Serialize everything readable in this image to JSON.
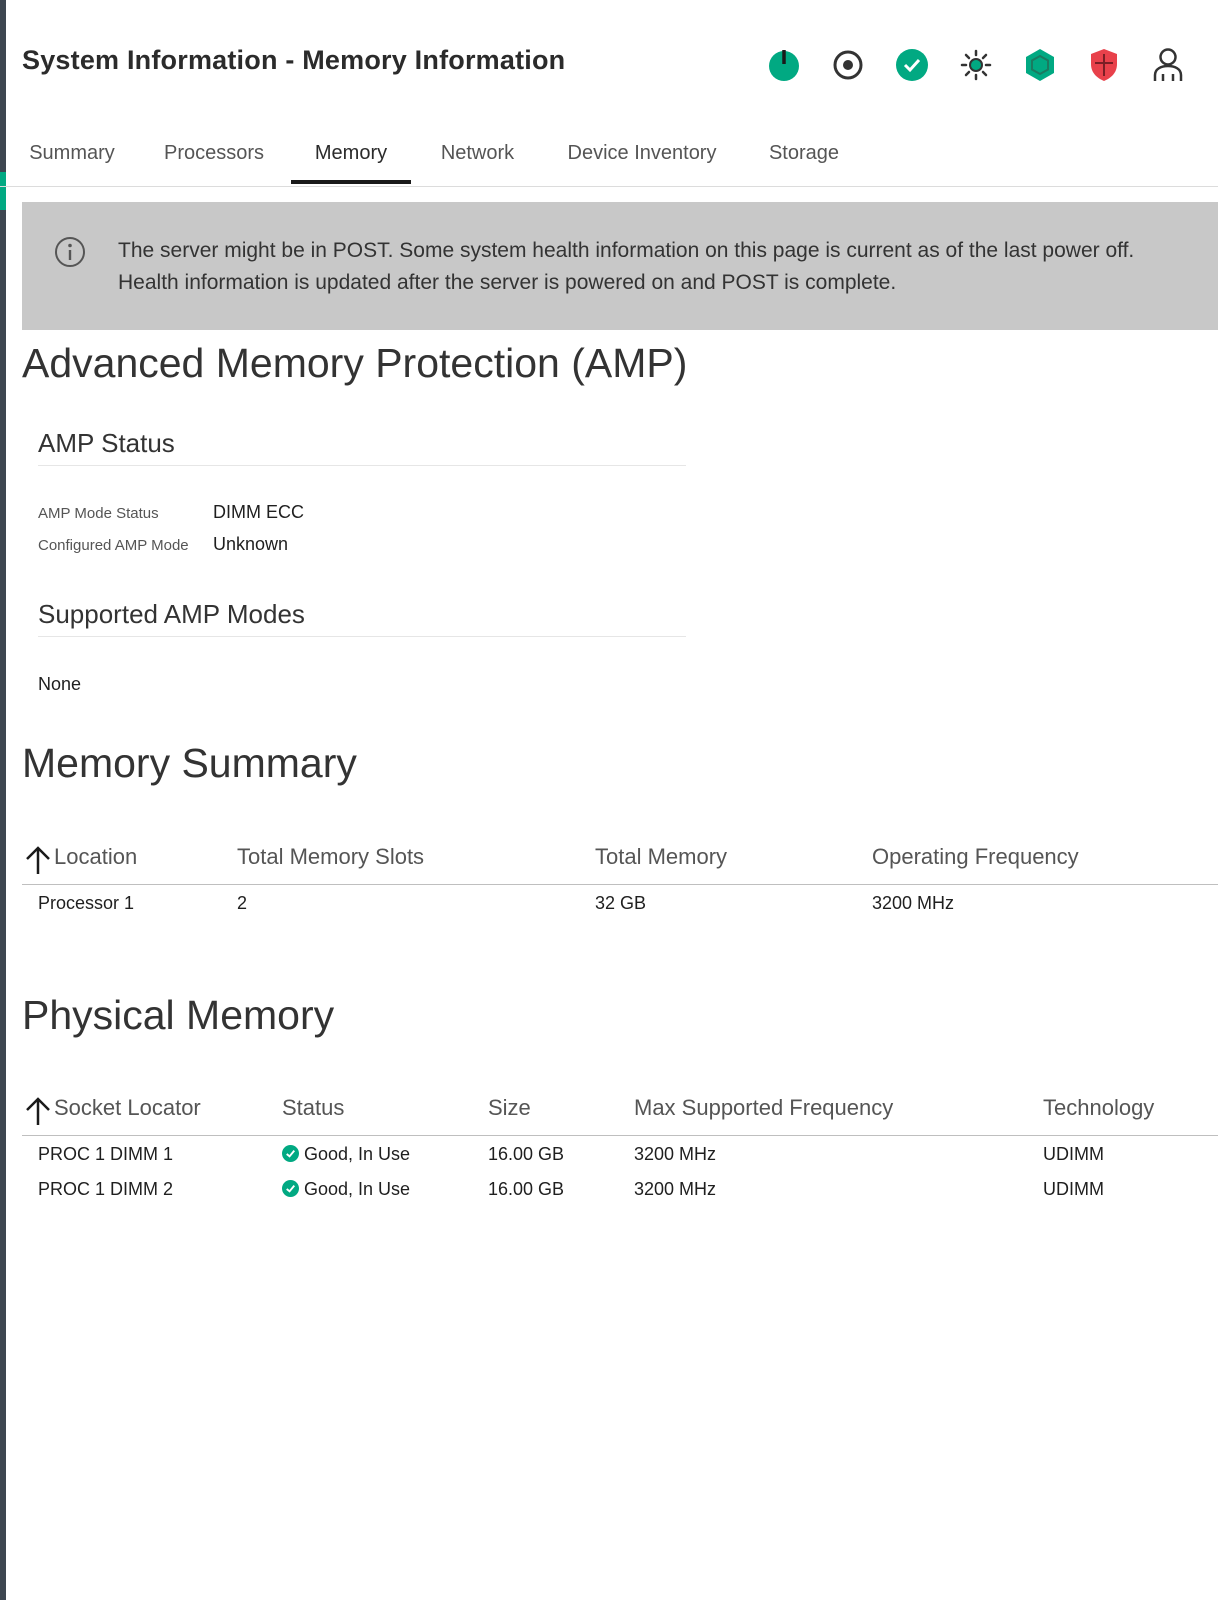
{
  "header": {
    "title": "System Information - Memory Information",
    "icons": [
      "power-icon",
      "uid-indicator-icon",
      "health-ok-icon",
      "ambient-light-icon",
      "security-hexagon-icon",
      "security-shield-icon",
      "user-icon"
    ]
  },
  "tabs": [
    {
      "label": "Summary"
    },
    {
      "label": "Processors"
    },
    {
      "label": "Memory"
    },
    {
      "label": "Network"
    },
    {
      "label": "Device Inventory"
    },
    {
      "label": "Storage"
    }
  ],
  "active_tab": "Memory",
  "banner": {
    "icon": "info-icon",
    "line1": "The server might be in POST. Some system health information on this page is current as of the last power off.",
    "line2": "Health information is updated after the server is powered on and POST is complete."
  },
  "amp": {
    "title": "Advanced Memory Protection (AMP)",
    "status_title": "AMP Status",
    "mode_status_label": "AMP Mode Status",
    "mode_status_value": "DIMM ECC",
    "configured_label": "Configured AMP Mode",
    "configured_value": "Unknown",
    "supported_title": "Supported AMP Modes",
    "supported_value": "None"
  },
  "memory_summary": {
    "title": "Memory Summary",
    "columns": [
      "Location",
      "Total Memory Slots",
      "Total Memory",
      "Operating Frequency"
    ],
    "rows": [
      [
        "Processor 1",
        "2",
        "32 GB",
        "3200 MHz"
      ]
    ]
  },
  "physical_memory": {
    "title": "Physical Memory",
    "columns": [
      "Socket Locator",
      "Status",
      "Size",
      "Max Supported Frequency",
      "Technology"
    ],
    "rows": [
      [
        "PROC 1 DIMM 1",
        "Good, In Use",
        "16.00 GB",
        "3200 MHz",
        "UDIMM"
      ],
      [
        "PROC 1 DIMM 2",
        "Good, In Use",
        "16.00 GB",
        "3200 MHz",
        "UDIMM"
      ]
    ]
  },
  "colors": {
    "accent": "#01a982",
    "shield_red": "#e8414b",
    "banner_bg": "#c8c8c8"
  }
}
